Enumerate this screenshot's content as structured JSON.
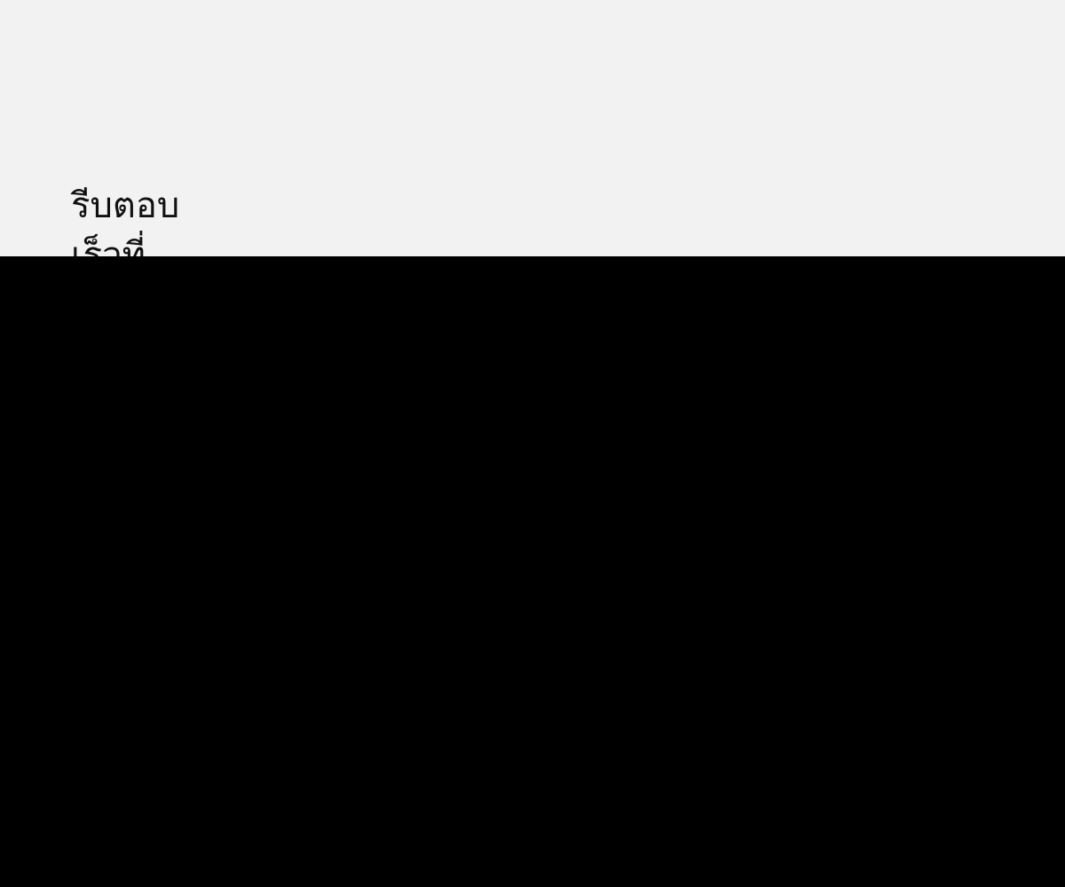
{
  "heading": {
    "line1": "รีบตอบ",
    "line2": "เร็วที่"
  },
  "colors": {
    "background": "#f2f2f2",
    "text": "#111111",
    "overlay": "#000000"
  }
}
